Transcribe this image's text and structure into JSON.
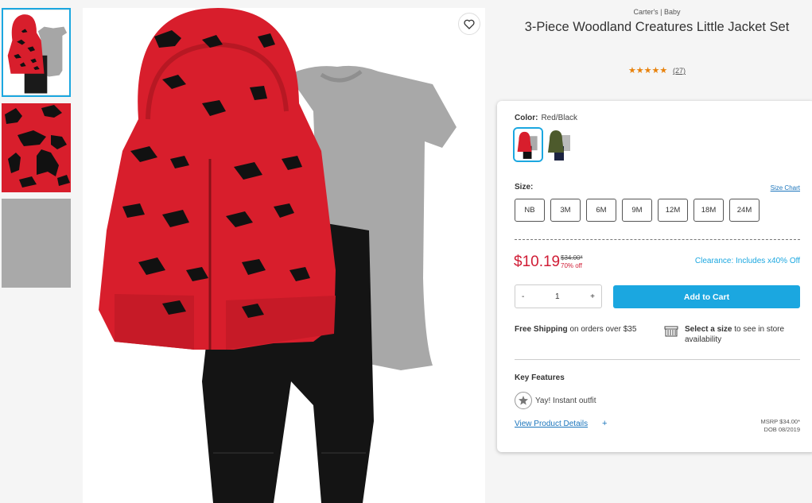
{
  "product": {
    "brand": "Carter's | Baby",
    "title": "3-Piece Woodland Creatures Little Jacket Set",
    "stars": "★★★★★",
    "rating_value": 5,
    "review_count": "(27)"
  },
  "thumbnails": [
    {
      "icon": "outfit-thumbnail",
      "active": true
    },
    {
      "icon": "jacket-detail-thumbnail",
      "active": false
    },
    {
      "icon": "fabric-detail-thumbnail",
      "active": false
    }
  ],
  "color": {
    "label": "Color:",
    "value": "Red/Black",
    "swatches": [
      {
        "name": "Red/Black",
        "selected": true
      },
      {
        "name": "Green",
        "selected": false
      }
    ]
  },
  "size": {
    "label": "Size:",
    "chart_link": "Size Chart",
    "options": [
      "NB",
      "3M",
      "6M",
      "9M",
      "12M",
      "18M",
      "24M"
    ]
  },
  "pricing": {
    "price": "$10.19",
    "was": "$34.00*",
    "discount": "70% off",
    "clearance": "Clearance: Includes x40% Off"
  },
  "cart": {
    "minus": "-",
    "quantity": "1",
    "plus": "+",
    "button": "Add to Cart"
  },
  "shipping": {
    "bold": "Free Shipping",
    "text": " on orders over $35"
  },
  "store": {
    "bold": "Select a size",
    "text": " to see in store availability",
    "icon": "store-icon"
  },
  "features": {
    "title": "Key Features",
    "items": [
      {
        "icon": "badge-icon",
        "text": "Yay! Instant outfit"
      }
    ]
  },
  "details": {
    "link": "View Product Details",
    "plus": "+",
    "msrp": "MSRP $34.00*",
    "dob": "DOB 08/2019"
  },
  "colors": {
    "accent": "#1ba7e0",
    "price_red": "#d01c35",
    "jacket_red": "#d81e2c",
    "star_orange": "#e8820c"
  }
}
